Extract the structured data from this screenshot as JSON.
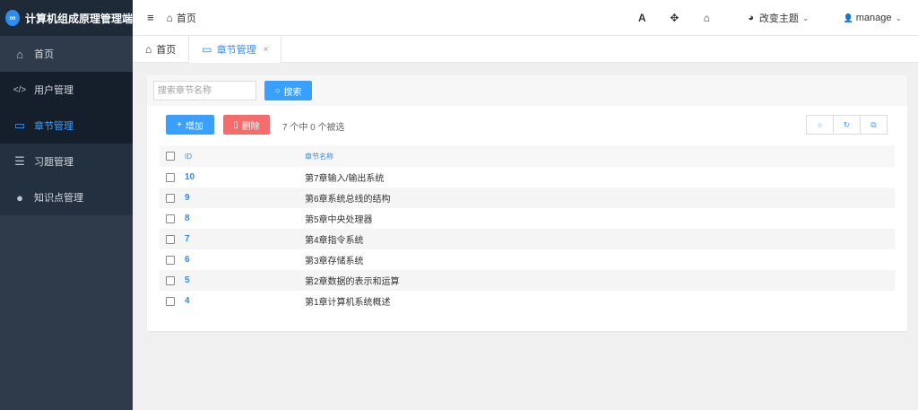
{
  "brand": {
    "title": "计算机组成原理管理端",
    "logo_text": "∞",
    "logo_color": "#2d8cf0"
  },
  "sidebar": {
    "items": [
      {
        "label": "首页",
        "icon": "home-icon",
        "glyph": "⌂"
      },
      {
        "label": "用户管理",
        "icon": "code-icon",
        "glyph": "</>"
      },
      {
        "label": "章节管理",
        "icon": "monitor-icon",
        "glyph": "▭",
        "active": true
      },
      {
        "label": "习题管理",
        "icon": "list-icon",
        "glyph": "☰"
      },
      {
        "label": "知识点管理",
        "icon": "circle-icon",
        "glyph": "●"
      }
    ]
  },
  "header": {
    "menu_glyph": "≡",
    "breadcrumb": "首页",
    "font_glyph": "A",
    "fullscreen_glyph": "✥",
    "home_glyph": "⌂",
    "theme_glyph": "◕",
    "theme_label": "改变主题",
    "user_glyph": "👤",
    "user_label": "manage",
    "chevron": "⌄"
  },
  "tabs": [
    {
      "label": "首页",
      "icon": "home-icon",
      "glyph": "⌂"
    },
    {
      "label": "章节管理",
      "icon": "monitor-icon",
      "glyph": "▭",
      "active": true,
      "close": "×"
    }
  ],
  "search": {
    "placeholder": "搜索章节名称",
    "button_label": "搜索",
    "button_glyph": "○"
  },
  "actions": {
    "add_label": "增加",
    "add_glyph": "+",
    "delete_label": "删除",
    "delete_glyph": "▯",
    "selection_info": "7 个中 0 个被选",
    "tool_search": "○",
    "tool_refresh": "↻",
    "tool_export": "⧉"
  },
  "table": {
    "columns": {
      "id": "ID",
      "name": "章节名称"
    },
    "rows": [
      {
        "id": "10",
        "name": "第7章输入/输出系统"
      },
      {
        "id": "9",
        "name": "第6章系统总线的结构"
      },
      {
        "id": "8",
        "name": "第5章中央处理器"
      },
      {
        "id": "7",
        "name": "第4章指令系统"
      },
      {
        "id": "6",
        "name": "第3章存储系统"
      },
      {
        "id": "5",
        "name": "第2章数据的表示和运算"
      },
      {
        "id": "4",
        "name": "第1章计算机系统概述"
      }
    ]
  },
  "colors": {
    "accent": "#3aa0ff",
    "danger": "#f56c6c",
    "sidebar": "#2f3a4a"
  }
}
